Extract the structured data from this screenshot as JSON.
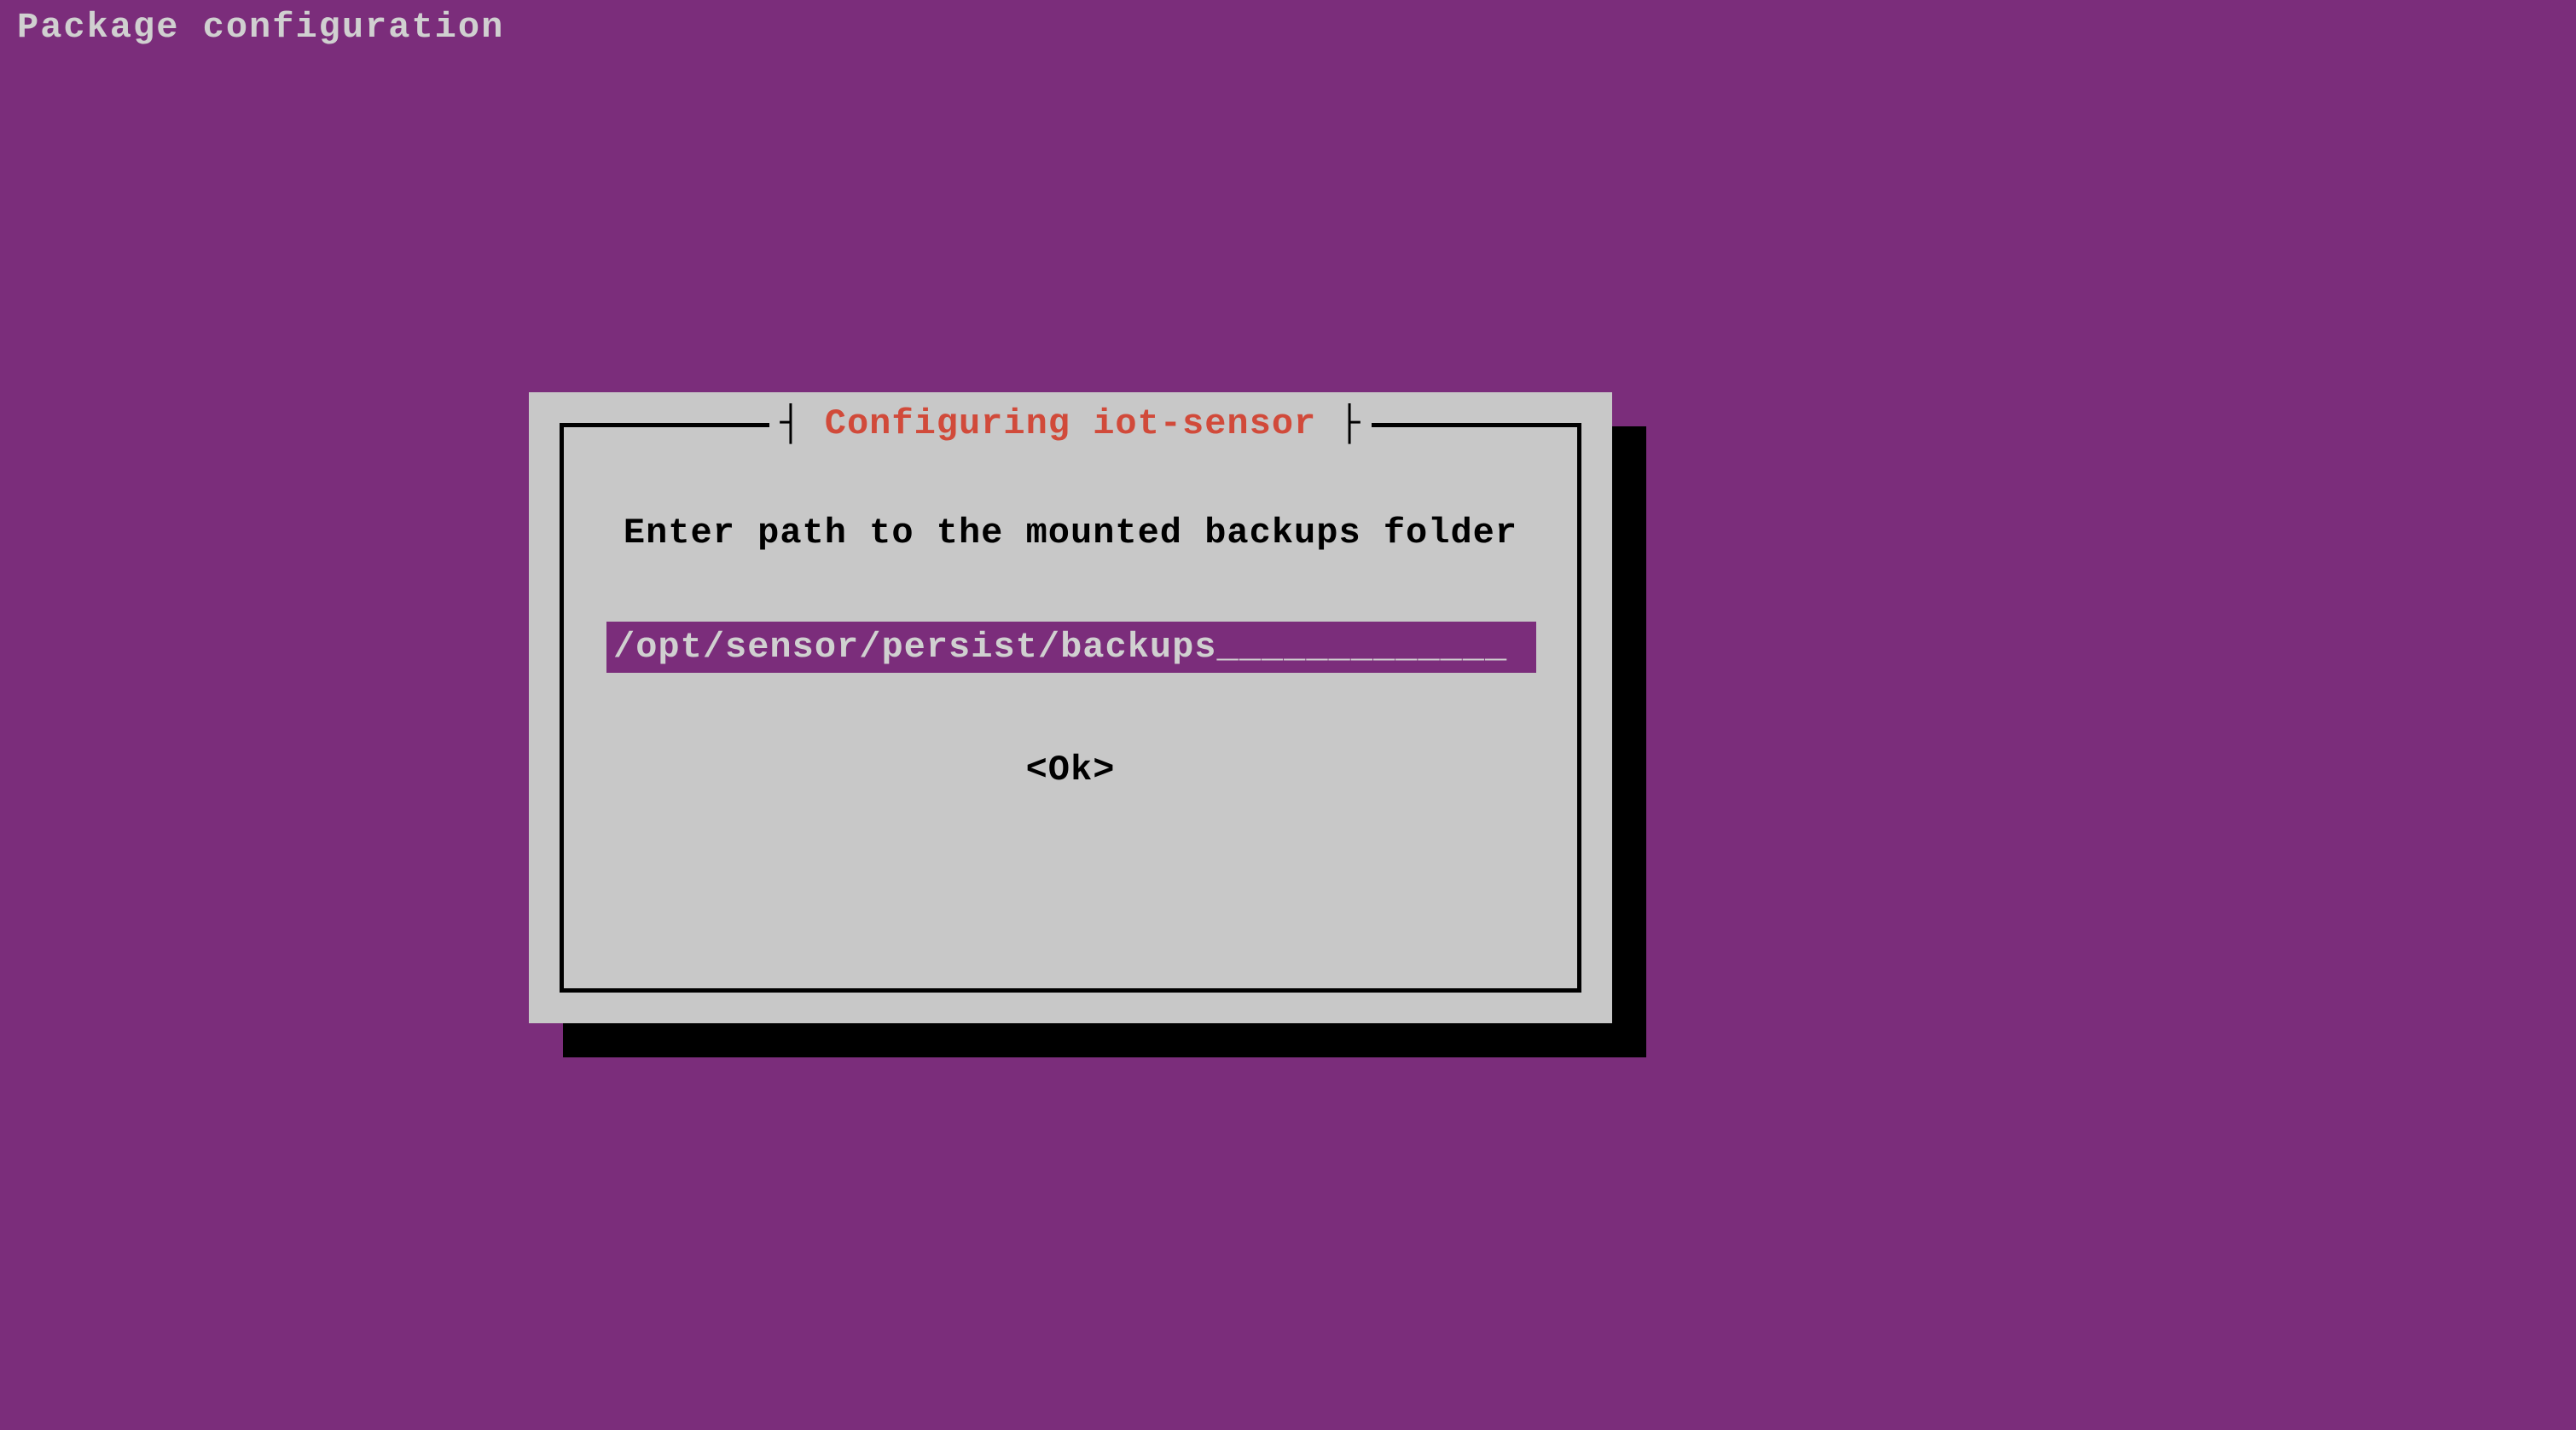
{
  "header": {
    "title": "Package configuration"
  },
  "dialog": {
    "title": "Configuring iot-sensor",
    "prompt": "Enter path to the mounted backups folder",
    "input_value": "/opt/sensor/persist/backups_____________",
    "ok_label": "<Ok>"
  },
  "colors": {
    "background": "#7b2d7b",
    "dialog_bg": "#c8c8c8",
    "dialog_title": "#d14a3a",
    "input_bg": "#7b2d7b",
    "input_text": "#d0d0d0",
    "text": "#000000",
    "shadow": "#000000"
  }
}
